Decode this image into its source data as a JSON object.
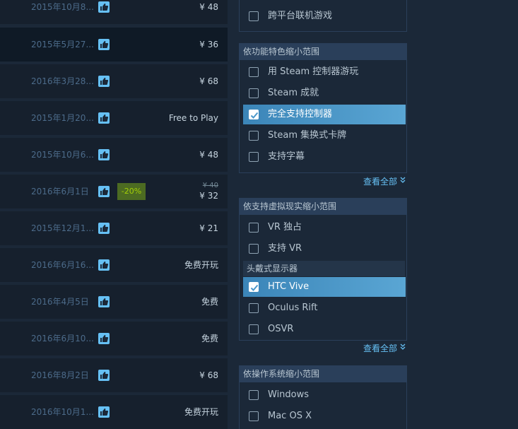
{
  "results": [
    {
      "date": "2015年10月8...",
      "price": "¥ 48"
    },
    {
      "date": "2015年5月27...",
      "price": "¥ 36"
    },
    {
      "date": "2016年3月28...",
      "price": "¥ 68"
    },
    {
      "date": "2015年1月20...",
      "price": "Free to Play"
    },
    {
      "date": "2015年10月6...",
      "price": "¥ 48"
    },
    {
      "date": "2016年6月1日",
      "discount": "-20%",
      "original_price": "¥ 40",
      "final_price": "¥ 32"
    },
    {
      "date": "2015年12月1...",
      "price": "¥ 21"
    },
    {
      "date": "2016年6月16...",
      "price": "免费开玩"
    },
    {
      "date": "2016年4月5日",
      "price": "免费"
    },
    {
      "date": "2016年6月10...",
      "price": "免费"
    },
    {
      "date": "2016年8月2日",
      "price": "¥ 68"
    },
    {
      "date": "2016年10月1...",
      "price": "免费开玩"
    }
  ],
  "filters": {
    "top_partial": {
      "option": "跨平台联机游戏"
    },
    "features": {
      "header": "依功能特色缩小范围",
      "options": [
        "用 Steam 控制器游玩",
        "Steam 成就",
        "完全支持控制器",
        "Steam 集换式卡牌",
        "支持字幕"
      ],
      "checked": "完全支持控制器",
      "see_all": "查看全部"
    },
    "vr": {
      "header": "依支持虚拟现实缩小范围",
      "options": [
        "VR 独占",
        "支持 VR"
      ],
      "subheader": "头戴式显示器",
      "headsets": [
        "HTC Vive",
        "Oculus Rift",
        "OSVR"
      ],
      "checked": "HTC Vive",
      "see_all": "查看全部"
    },
    "os": {
      "header": "依操作系统缩小范围",
      "options": [
        "Windows",
        "Mac OS X"
      ]
    }
  },
  "colors": {
    "background": "#1b2838",
    "accent": "#66c0f4",
    "selected": "#4b98cb",
    "discount_bg": "#4c6b22",
    "discount_text": "#a4d007"
  },
  "icons": {
    "thumb": "thumbs-up-icon",
    "check": "checkmark-icon",
    "chevron": "double-chevron-down-icon"
  }
}
